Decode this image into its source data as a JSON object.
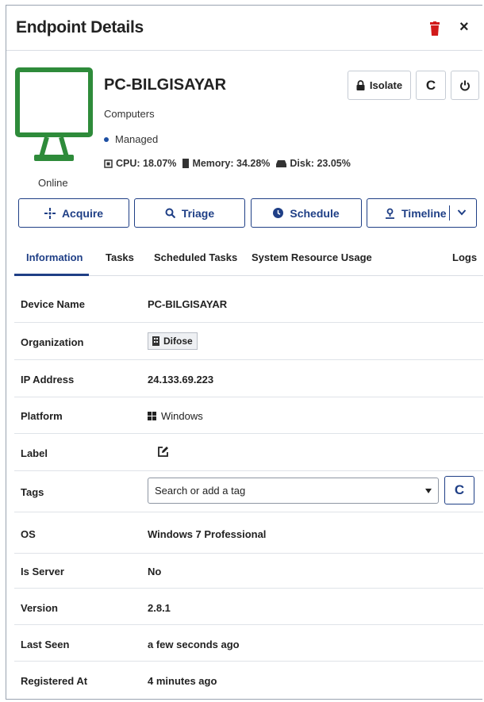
{
  "header": {
    "title": "Endpoint Details"
  },
  "endpoint": {
    "name": "PC-BILGISAYAR",
    "group": "Computers",
    "managed": "Managed",
    "status": "Online",
    "stats": {
      "cpu": "CPU: 18.07%",
      "memory": "Memory: 34.28%",
      "disk": "Disk: 23.05%"
    }
  },
  "toolbar": {
    "isolate_label": "Isolate",
    "refresh_glyph": "C"
  },
  "actions": {
    "acquire_label": "Acquire",
    "triage_label": "Triage",
    "schedule_label": "Schedule",
    "timeline_label": "Timeline"
  },
  "tabs": [
    {
      "label": "Information",
      "active": true
    },
    {
      "label": "Tasks"
    },
    {
      "label": "Scheduled Tasks"
    },
    {
      "label": "System Resource Usage"
    },
    {
      "label": "Logs"
    }
  ],
  "info": {
    "device_name": {
      "label": "Device Name",
      "value": "PC-BILGISAYAR"
    },
    "organization": {
      "label": "Organization",
      "value": "Difose"
    },
    "ip_address": {
      "label": "IP Address",
      "value": "24.133.69.223"
    },
    "platform": {
      "label": "Platform",
      "value": "Windows"
    },
    "label": {
      "label": "Label"
    },
    "tags": {
      "label": "Tags",
      "placeholder": "Search or add a tag"
    },
    "os": {
      "label": "OS",
      "value": "Windows 7 Professional"
    },
    "is_server": {
      "label": "Is Server",
      "value": "No"
    },
    "version": {
      "label": "Version",
      "value": "2.8.1"
    },
    "last_seen": {
      "label": "Last Seen",
      "value": "a few seconds ago"
    },
    "registered_at": {
      "label": "Registered At",
      "value": "4 minutes ago"
    }
  },
  "colors": {
    "accent": "#1f3f86",
    "online": "#2e8b3a",
    "delete": "#d11a1a",
    "managed_dot": "#1d4fa3"
  },
  "icons": [
    "trash-icon",
    "close-icon",
    "monitor-icon",
    "lock-icon",
    "refresh-icon",
    "power-icon",
    "crosshair-icon",
    "search-icon",
    "clock-icon",
    "pin-icon",
    "chevron-down-icon",
    "building-icon",
    "windows-icon",
    "edit-icon",
    "cpu-icon",
    "memory-icon",
    "disk-icon"
  ]
}
